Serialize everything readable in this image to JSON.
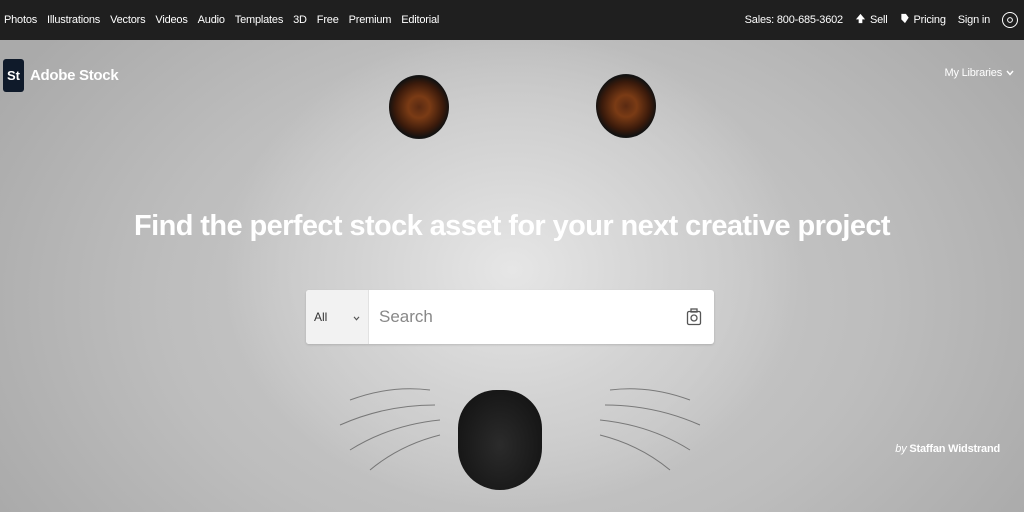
{
  "topbar": {
    "nav": [
      "Photos",
      "Illustrations",
      "Vectors",
      "Videos",
      "Audio",
      "Templates",
      "3D",
      "Free",
      "Premium",
      "Editorial"
    ],
    "sales": "Sales: 800-685-3602",
    "sell": "Sell",
    "pricing": "Pricing",
    "sign_in": "Sign in"
  },
  "brand": {
    "logo": "St",
    "name": "Adobe Stock"
  },
  "my_libraries": "My Libraries",
  "headline": "Find the perfect stock asset for your next creative project",
  "search": {
    "scope": "All",
    "placeholder": "Search"
  },
  "credit": {
    "prefix": "by",
    "author": "Staffan Widstrand"
  },
  "icons": [
    "sell-icon",
    "pricing-tag-icon",
    "globe-icon",
    "chevron-down-icon",
    "camera-icon"
  ]
}
